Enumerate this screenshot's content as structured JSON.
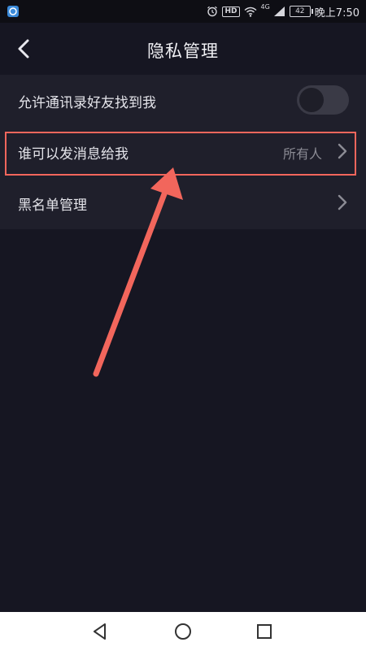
{
  "status_bar": {
    "hd_label": "HD",
    "network_label": "4G",
    "battery_level": "42",
    "time": "晚上7:50",
    "icons": [
      "app-notification-icon",
      "alarm-icon",
      "wifi-icon",
      "signal-icon",
      "battery-icon"
    ]
  },
  "header": {
    "title": "隐私管理",
    "back_icon": "chevron-left-icon"
  },
  "settings": {
    "items": [
      {
        "label": "允许通讯录好友找到我",
        "control": "toggle",
        "enabled": false
      },
      {
        "label": "谁可以发消息给我",
        "value": "所有人",
        "control": "chevron-right-icon"
      },
      {
        "label": "黑名单管理",
        "control": "chevron-right-icon"
      }
    ]
  },
  "annotation": {
    "highlight_color": "#f2665c",
    "arrow_color": "#f2665c"
  },
  "nav_bar": {
    "buttons": [
      "back-triangle-icon",
      "home-circle-icon",
      "recents-square-icon"
    ]
  },
  "colors": {
    "background": "#161622",
    "list_background": "#1f1f2b",
    "accent_annotation": "#f2665c"
  }
}
